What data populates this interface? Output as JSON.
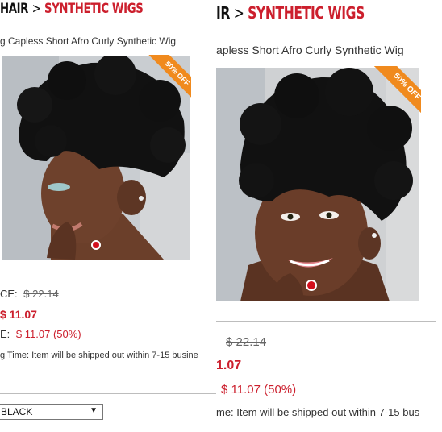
{
  "left": {
    "breadcrumb": {
      "parent": "HAIR",
      "separator": ">",
      "category": "SYNTHETIC WIGS"
    },
    "product_title": "g Capless Short Afro Curly Synthetic Wig",
    "badge": "50% OFF",
    "list_price_label": "CE:",
    "list_price": "$ 22.14",
    "price": "$ 11.07",
    "save_label": "E:",
    "save_value": "$ 11.07 (50%)",
    "shipping": "g Time: Item will be shipped out within 7-15 busine",
    "color_select": {
      "value": "BLACK"
    }
  },
  "right": {
    "breadcrumb": {
      "parent": "IR",
      "separator": ">",
      "category": "SYNTHETIC WIGS"
    },
    "product_title": "apless Short Afro Curly Synthetic Wig",
    "badge": "50% OFF",
    "list_price": "$ 22.14",
    "price": "1.07",
    "save_value": "$ 11.07 (50%)",
    "shipping": "me: Item will be shipped out within 7-15 bus"
  },
  "colors": {
    "accent_red": "#cc1f2d",
    "badge_orange": "#f08a1e",
    "hair": "#111111",
    "skin": "#6b3f2a"
  }
}
